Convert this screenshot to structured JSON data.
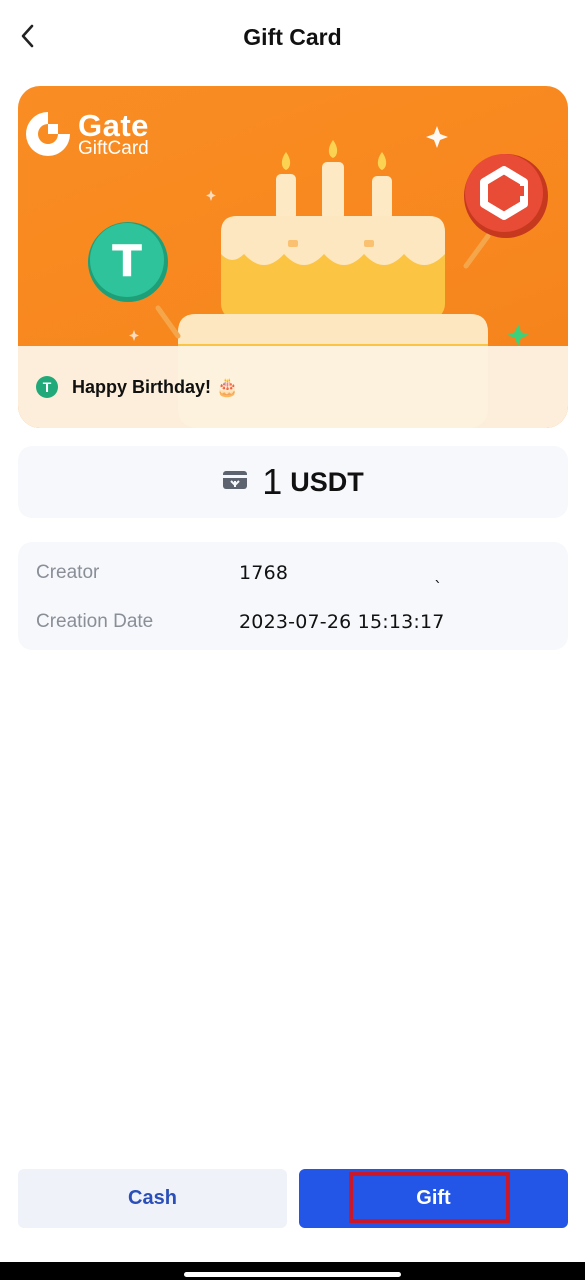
{
  "header": {
    "title": "Gift Card",
    "back_icon": "chevron-left-icon"
  },
  "card": {
    "brand_name": "Gate",
    "brand_sub": "GiftCard",
    "greeting": "Happy Birthday!",
    "greeting_emoji": "🎂",
    "colors": {
      "background": "#f98d23",
      "greeting_bar": "#fdf4e8",
      "usdt_coin": "#2fc39b",
      "gate_coin": "#e84b36"
    }
  },
  "amount": {
    "icon": "gift-card-icon",
    "value": "1",
    "currency": "USDT"
  },
  "info": {
    "creator_label": "Creator",
    "creator_value": "1768",
    "creator_trailing": "ˎ",
    "date_label": "Creation Date",
    "date_value": "2023-07-26 15:13:17"
  },
  "actions": {
    "cash_label": "Cash",
    "gift_label": "Gift"
  },
  "colors": {
    "primary": "#2356e6",
    "secondary_bg": "#eff2f9",
    "secondary_text": "#2a4fb8",
    "highlight": "#c8192c"
  }
}
